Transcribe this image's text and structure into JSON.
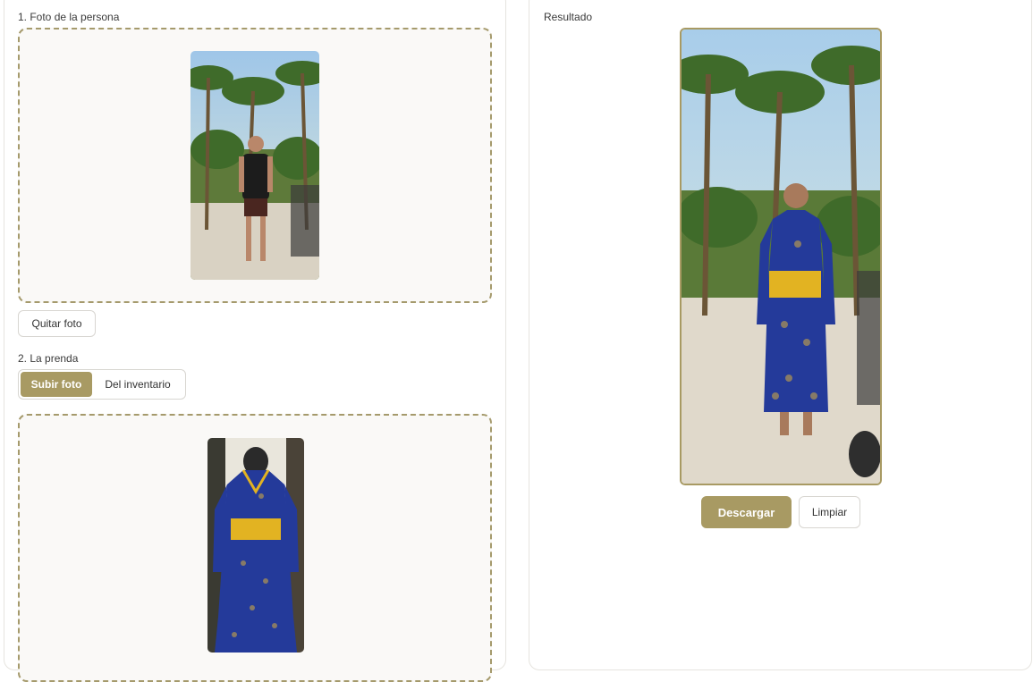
{
  "left": {
    "person_section_label": "1. Foto de la persona",
    "remove_photo_label": "Quitar foto",
    "garment_section_label": "2. La prenda",
    "garment_tabs": [
      {
        "label": "Subir foto",
        "active": true
      },
      {
        "label": "Del inventario",
        "active": false
      }
    ]
  },
  "right": {
    "result_label": "Resultado",
    "download_label": "Descargar",
    "clear_label": "Limpiar"
  },
  "colors": {
    "accent": "#a89a63",
    "dashed_border": "#a59a6c",
    "panel_border": "#e6e4df"
  }
}
